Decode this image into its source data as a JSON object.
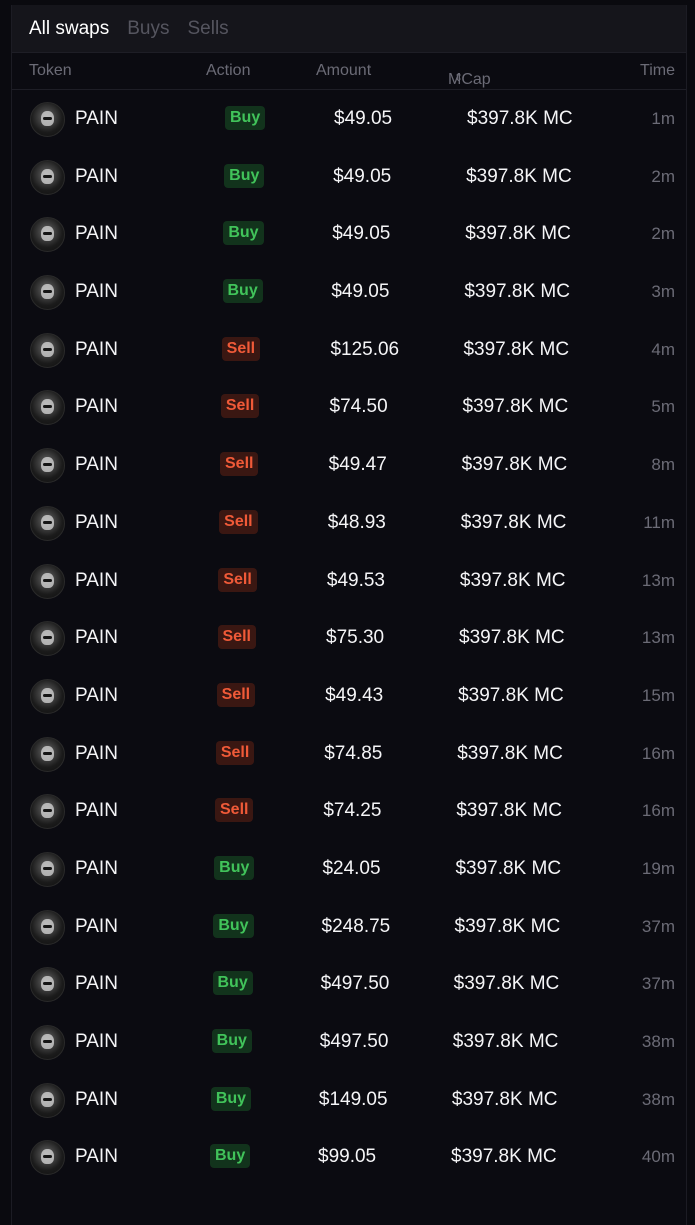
{
  "tabs": [
    {
      "label": "All swaps",
      "active": true
    },
    {
      "label": "Buys",
      "active": false
    },
    {
      "label": "Sells",
      "active": false
    }
  ],
  "columns": {
    "token": "Token",
    "action": "Action",
    "amount": "Amount",
    "mcap": "MCap",
    "time": "Time"
  },
  "colors": {
    "buy_text": "#41c35a",
    "buy_bg": "#12331c",
    "sell_text": "#f05a38",
    "sell_bg": "#3a1712"
  },
  "rows": [
    {
      "token": "PAIN",
      "action": "Buy",
      "amount": "$49.05",
      "mcap": "$397.8K MC",
      "time": "1m"
    },
    {
      "token": "PAIN",
      "action": "Buy",
      "amount": "$49.05",
      "mcap": "$397.8K MC",
      "time": "2m"
    },
    {
      "token": "PAIN",
      "action": "Buy",
      "amount": "$49.05",
      "mcap": "$397.8K MC",
      "time": "2m"
    },
    {
      "token": "PAIN",
      "action": "Buy",
      "amount": "$49.05",
      "mcap": "$397.8K MC",
      "time": "3m"
    },
    {
      "token": "PAIN",
      "action": "Sell",
      "amount": "$125.06",
      "mcap": "$397.8K MC",
      "time": "4m"
    },
    {
      "token": "PAIN",
      "action": "Sell",
      "amount": "$74.50",
      "mcap": "$397.8K MC",
      "time": "5m"
    },
    {
      "token": "PAIN",
      "action": "Sell",
      "amount": "$49.47",
      "mcap": "$397.8K MC",
      "time": "8m"
    },
    {
      "token": "PAIN",
      "action": "Sell",
      "amount": "$48.93",
      "mcap": "$397.8K MC",
      "time": "11m"
    },
    {
      "token": "PAIN",
      "action": "Sell",
      "amount": "$49.53",
      "mcap": "$397.8K MC",
      "time": "13m"
    },
    {
      "token": "PAIN",
      "action": "Sell",
      "amount": "$75.30",
      "mcap": "$397.8K MC",
      "time": "13m"
    },
    {
      "token": "PAIN",
      "action": "Sell",
      "amount": "$49.43",
      "mcap": "$397.8K MC",
      "time": "15m"
    },
    {
      "token": "PAIN",
      "action": "Sell",
      "amount": "$74.85",
      "mcap": "$397.8K MC",
      "time": "16m"
    },
    {
      "token": "PAIN",
      "action": "Sell",
      "amount": "$74.25",
      "mcap": "$397.8K MC",
      "time": "16m"
    },
    {
      "token": "PAIN",
      "action": "Buy",
      "amount": "$24.05",
      "mcap": "$397.8K MC",
      "time": "19m"
    },
    {
      "token": "PAIN",
      "action": "Buy",
      "amount": "$248.75",
      "mcap": "$397.8K MC",
      "time": "37m"
    },
    {
      "token": "PAIN",
      "action": "Buy",
      "amount": "$497.50",
      "mcap": "$397.8K MC",
      "time": "37m"
    },
    {
      "token": "PAIN",
      "action": "Buy",
      "amount": "$497.50",
      "mcap": "$397.8K MC",
      "time": "38m"
    },
    {
      "token": "PAIN",
      "action": "Buy",
      "amount": "$149.05",
      "mcap": "$397.8K MC",
      "time": "38m"
    },
    {
      "token": "PAIN",
      "action": "Buy",
      "amount": "$99.05",
      "mcap": "$397.8K MC",
      "time": "40m"
    }
  ]
}
